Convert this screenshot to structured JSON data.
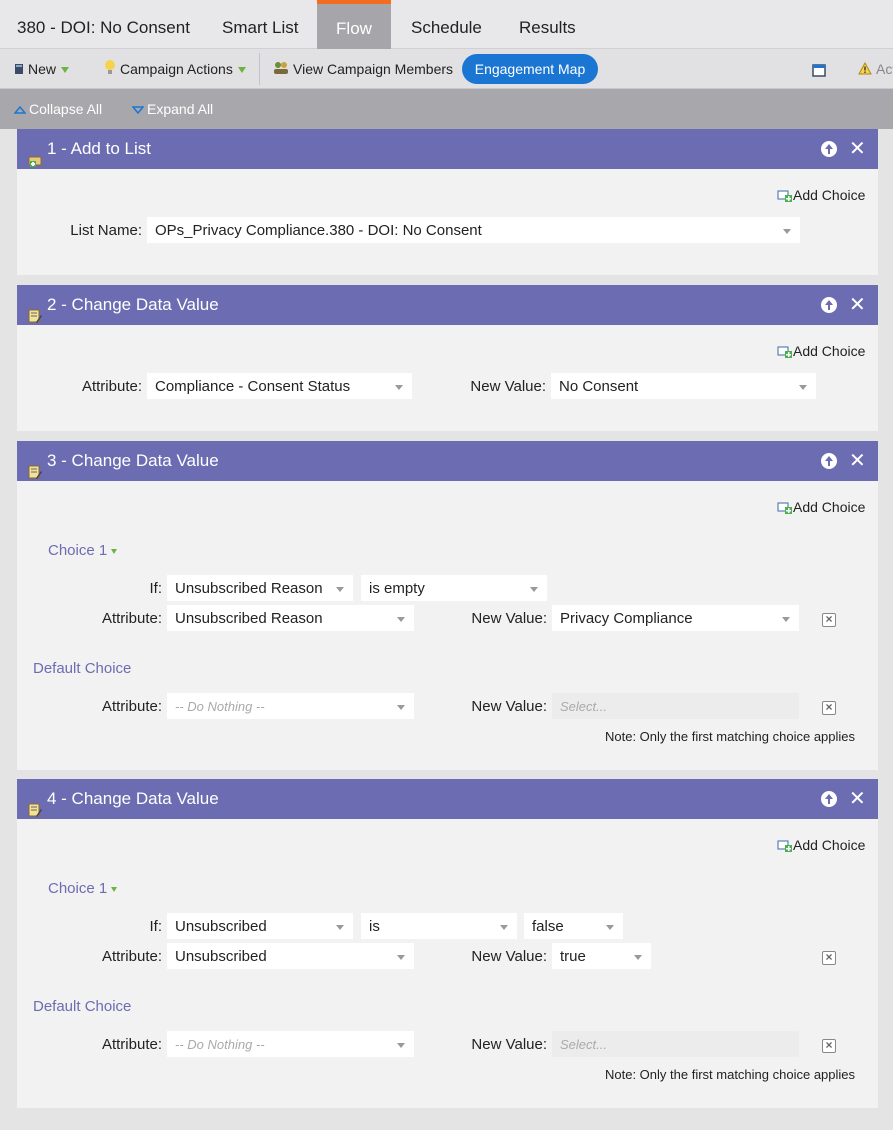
{
  "tabs": {
    "campaign_title": "380 - DOI: No Consent",
    "smart_list": "Smart List",
    "flow": "Flow",
    "schedule": "Schedule",
    "results": "Results"
  },
  "toolbar": {
    "new": "New",
    "campaign_actions": "Campaign Actions",
    "view_members": "View Campaign Members",
    "engagement_map": "Engagement Map",
    "truncated_item": "Act"
  },
  "subbar": {
    "collapse_all": "Collapse All",
    "expand_all": "Expand All"
  },
  "common": {
    "add_choice": "Add Choice",
    "attribute_label": "Attribute:",
    "new_value_label": "New Value:",
    "if_label": "If:",
    "list_name_label": "List Name:",
    "default_choice": "Default Choice",
    "choice_1": "Choice 1",
    "do_nothing": "-- Do Nothing --",
    "select_placeholder": "Select...",
    "note": "Note: Only the first matching choice applies"
  },
  "steps": [
    {
      "title": "1 - Add to List",
      "list_name": "OPs_Privacy Compliance.380 - DOI: No Consent"
    },
    {
      "title": "2 - Change Data Value",
      "attribute": "Compliance - Consent Status",
      "new_value": "No Consent"
    },
    {
      "title": "3 - Change Data Value",
      "if_field": "Unsubscribed Reason",
      "if_operator": "is empty",
      "attribute": "Unsubscribed Reason",
      "new_value": "Privacy Compliance"
    },
    {
      "title": "4 - Change Data Value",
      "if_field": "Unsubscribed",
      "if_operator": "is",
      "if_value": "false",
      "attribute": "Unsubscribed",
      "new_value": "true"
    }
  ],
  "colors": {
    "step_header": "#6c6cb2",
    "accent_orange": "#f36d21",
    "engagement_blue": "#1a76d2"
  }
}
